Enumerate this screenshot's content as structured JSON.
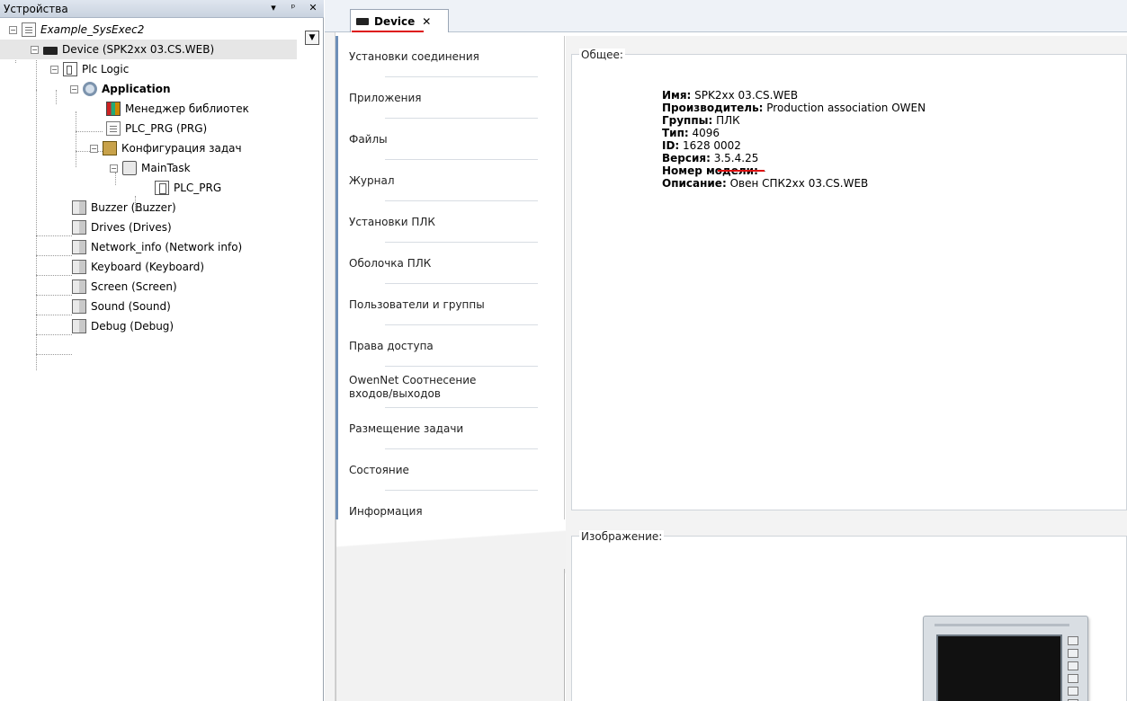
{
  "devices_panel": {
    "title": "Устройства",
    "controls": {
      "dropdown": "▾",
      "pin": "ᵖ",
      "close": "✕"
    },
    "tree": [
      {
        "label": "Example_SysExec2",
        "italic": true,
        "icon": "project-icon"
      },
      {
        "label": "Device (SPK2xx 03.CS.WEB)",
        "icon": "device-icon",
        "selected": true
      },
      {
        "label": "Plc Logic",
        "icon": "plc-logic-icon"
      },
      {
        "label": "Application",
        "bold": true,
        "icon": "gear-icon"
      },
      {
        "label": "Менеджер библиотек",
        "icon": "library-icon"
      },
      {
        "label": "PLC_PRG (PRG)",
        "icon": "pou-icon"
      },
      {
        "label": "Конфигурация задач",
        "icon": "task-config-icon"
      },
      {
        "label": "MainTask",
        "icon": "task-icon"
      },
      {
        "label": "PLC_PRG",
        "icon": "program-call-icon"
      },
      {
        "label": "Buzzer (Buzzer)",
        "icon": "module-icon"
      },
      {
        "label": "Drives (Drives)",
        "icon": "module-icon"
      },
      {
        "label": "Network_info (Network info)",
        "icon": "module-icon"
      },
      {
        "label": "Keyboard (Keyboard)",
        "icon": "module-icon"
      },
      {
        "label": "Screen (Screen)",
        "icon": "module-icon"
      },
      {
        "label": "Sound (Sound)",
        "icon": "module-icon"
      },
      {
        "label": "Debug (Debug)",
        "icon": "module-icon"
      }
    ]
  },
  "editor": {
    "tab": {
      "label": "Device",
      "close": "✕"
    },
    "nav": [
      "Установки соединения",
      "Приложения",
      "Файлы",
      "Журнал",
      "Установки ПЛК",
      "Оболочка ПЛК",
      "Пользователи и группы",
      "Права доступа",
      "OwenNet Соотнесение входов/выходов",
      "Размещение задачи",
      "Состояние",
      "Информация"
    ],
    "active_nav": "Информация",
    "general": {
      "legend": "Общее:",
      "rows": [
        {
          "key": "Имя:",
          "value": " SPK2xx 03.CS.WEB"
        },
        {
          "key": "Производитель:",
          "value": " Production association OWEN"
        },
        {
          "key": "Группы:",
          "value": " ПЛК"
        },
        {
          "key": "Тип:",
          "value": " 4096"
        },
        {
          "key": "ID:",
          "value": " 1628 0002"
        },
        {
          "key": "Версия:",
          "value": " 3.5.4.25"
        },
        {
          "key": "Номер модели:",
          "value": " -"
        },
        {
          "key": "Описание:",
          "value": " Овен СПК2xx 03.CS.WEB"
        }
      ]
    },
    "image_group": {
      "legend": "Изображение:"
    }
  }
}
